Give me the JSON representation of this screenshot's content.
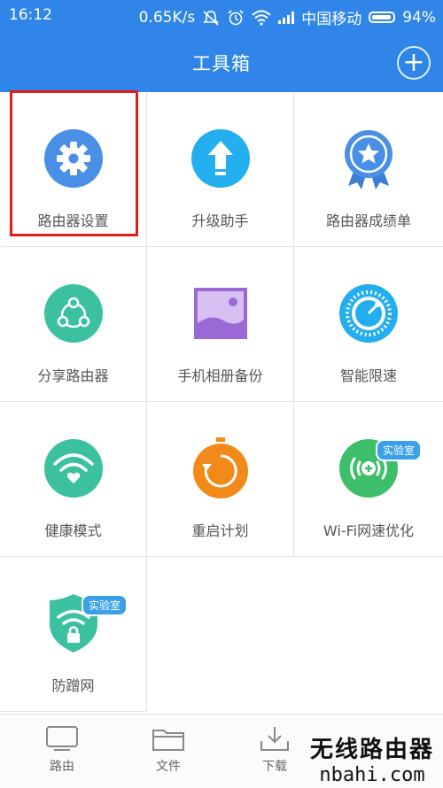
{
  "status_bar": {
    "time": "16:12",
    "speed": "0.65K/s",
    "carrier": "中国移动",
    "battery": "94%",
    "battery_level": 0.94
  },
  "header": {
    "title": "工具箱",
    "add_label": "+"
  },
  "tools": [
    {
      "label": "路由器设置",
      "icon": "gear-icon",
      "color": "#4a8fe6"
    },
    {
      "label": "升级助手",
      "icon": "upgrade-arrow-icon",
      "color": "#23aef0"
    },
    {
      "label": "路由器成绩单",
      "icon": "star-medal-icon",
      "color": "#4a8fe6"
    },
    {
      "label": "分享路由器",
      "icon": "share-icon",
      "color": "#3cc1a0"
    },
    {
      "label": "手机相册备份",
      "icon": "photo-album-icon",
      "color": "#9b69d6"
    },
    {
      "label": "智能限速",
      "icon": "speed-gauge-icon",
      "color": "#23aef0"
    },
    {
      "label": "健康模式",
      "icon": "wifi-heart-icon",
      "color": "#3cc1a0"
    },
    {
      "label": "重启计划",
      "icon": "restart-timer-icon",
      "color": "#f28a1a"
    },
    {
      "label": "Wi-Fi网速优化",
      "icon": "wifi-boost-icon",
      "color": "#3cbf68",
      "badge": "实验室"
    },
    {
      "label": "防蹭网",
      "icon": "shield-lock-icon",
      "color": "#3cc1a0",
      "badge": "实验室"
    }
  ],
  "tabs": [
    {
      "label": "路由",
      "icon": "router-tv-icon"
    },
    {
      "label": "文件",
      "icon": "folder-icon"
    },
    {
      "label": "下载",
      "icon": "download-icon"
    }
  ],
  "watermark": {
    "line1": "无线路由器",
    "line2": "nbahi.com"
  }
}
